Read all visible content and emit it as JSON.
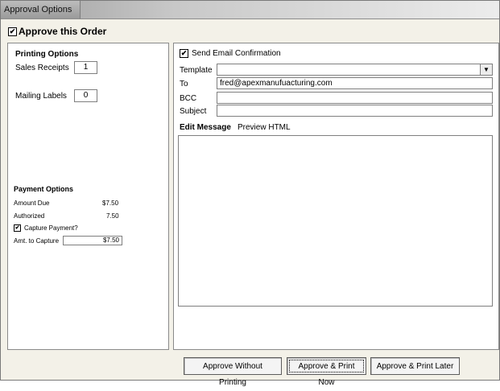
{
  "window": {
    "title": "Approval Options"
  },
  "approve": {
    "label": "Approve this Order",
    "checked": "✔"
  },
  "printing": {
    "heading": "Printing Options",
    "sales_receipts_label": "Sales Receipts",
    "sales_receipts_value": "1",
    "mailing_labels_label": "Mailing Labels",
    "mailing_labels_value": "0"
  },
  "payment": {
    "heading": "Payment Options",
    "amount_due_label": "Amount Due",
    "amount_due_value": "$7.50",
    "authorized_label": "Authorized",
    "authorized_value": "7.50",
    "capture_label": "Capture Payment?",
    "capture_checked": "✔",
    "amt_capture_label": "Amt. to Capture",
    "amt_capture_value": "$7.50"
  },
  "email": {
    "send_label": "Send Email Confirmation",
    "send_checked": "✔",
    "template_label": "Template",
    "template_value": "",
    "to_label": "To",
    "to_value": "fred@apexmanufuacturing.com",
    "bcc_label": "BCC",
    "bcc_value": "",
    "subject_label": "Subject",
    "subject_value": "",
    "edit_tab": "Edit Message",
    "preview_tab": "Preview HTML",
    "message_body": ""
  },
  "buttons": {
    "approve_no_print": "Approve Without Printing",
    "approve_print_now": "Approve & Print Now",
    "approve_print_later": "Approve & Print Later"
  },
  "colors": {
    "window_bg": "#f3f1e8",
    "panel_bg": "#ffffff"
  },
  "icons": {
    "dropdown": "chevron-down-icon",
    "check": "checkmark-icon"
  }
}
